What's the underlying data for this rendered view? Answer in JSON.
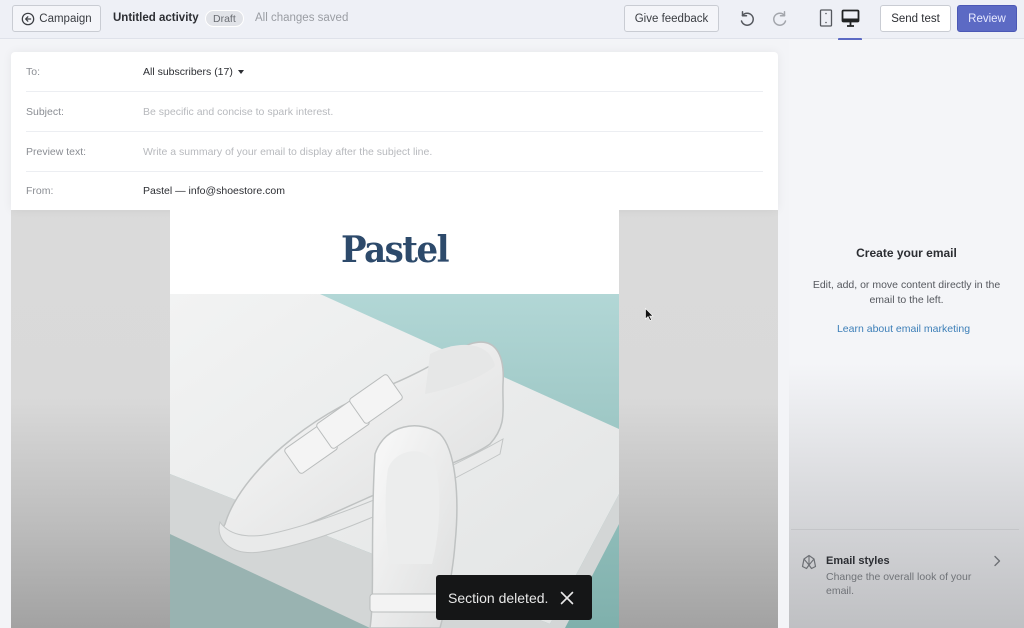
{
  "topbar": {
    "back_label": "Campaign",
    "title": "Untitled activity",
    "status_badge": "Draft",
    "save_status": "All changes saved",
    "feedback_label": "Give feedback",
    "send_test_label": "Send test",
    "review_label": "Review",
    "active_view": "desktop",
    "accent_color": "#5c6ac4"
  },
  "header_fields": {
    "to": {
      "label": "To:",
      "value": "All subscribers (17)"
    },
    "subject": {
      "label": "Subject:",
      "placeholder": "Be specific and concise to spark interest."
    },
    "preview": {
      "label": "Preview text:",
      "placeholder": "Write a summary of your email to display after the subject line."
    },
    "from": {
      "label": "From:",
      "value": "Pastel — info@shoestore.com"
    }
  },
  "email": {
    "logo_text": "Pastel",
    "hero_image": "white-velcro-sneakers-photo"
  },
  "toast": {
    "message": "Section deleted."
  },
  "right_panel": {
    "title": "Create your email",
    "description": "Edit, add, or move content directly in the email to the left.",
    "link": "Learn about email marketing",
    "email_styles": {
      "title": "Email styles",
      "description": "Change the overall look of your email."
    }
  }
}
